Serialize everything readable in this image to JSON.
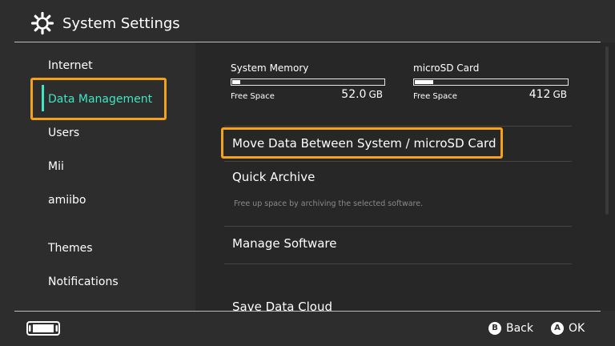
{
  "header": {
    "title": "System Settings",
    "icon": "gear-icon"
  },
  "sidebar": {
    "items": [
      {
        "label": "Internet"
      },
      {
        "label": "Data Management"
      },
      {
        "label": "Users"
      },
      {
        "label": "Mii"
      },
      {
        "label": "amiibo"
      },
      {
        "label": "Themes"
      },
      {
        "label": "Notifications"
      }
    ],
    "selected": "Data Management"
  },
  "storage": {
    "system": {
      "label": "System Memory",
      "free_label": "Free Space",
      "free_value": "52.0",
      "unit": "GB",
      "used_fraction": 0.05
    },
    "microsd": {
      "label": "microSD Card",
      "free_label": "Free Space",
      "free_value": "412",
      "unit": "GB",
      "used_fraction": 0.12
    }
  },
  "menu": {
    "move_data": "Move Data Between System / microSD Card",
    "quick_archive": "Quick Archive",
    "quick_archive_desc": "Free up space by archiving the selected software.",
    "manage_software": "Manage Software",
    "save_data_cloud": "Save Data Cloud"
  },
  "footer": {
    "back_button": "B",
    "back_label": "Back",
    "ok_button": "A",
    "ok_label": "OK"
  },
  "colors": {
    "accent": "#3ee6c4",
    "highlight": "#f5a21b",
    "background": "#2d2d2d"
  }
}
